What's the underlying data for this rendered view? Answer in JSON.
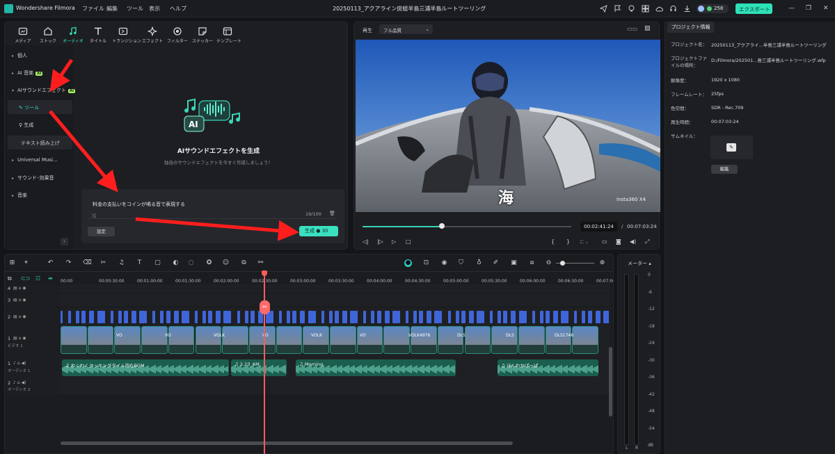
{
  "titlebar": {
    "app_name": "Wondershare Filmora",
    "menu": [
      "ファイル",
      "編集",
      "ツール",
      "表示",
      "ヘルプ"
    ],
    "project_title": "20250113_アクアライン房総半島三浦半島ルートツーリング",
    "credits": "258",
    "export_label": "エクスポート"
  },
  "media_tabs": [
    {
      "label": "メディア",
      "icon": "media-icon"
    },
    {
      "label": "ストック",
      "icon": "stock-icon"
    },
    {
      "label": "オーディオ",
      "icon": "music-note-icon"
    },
    {
      "label": "タイトル",
      "icon": "title-icon"
    },
    {
      "label": "トランジション",
      "icon": "transition-icon"
    },
    {
      "label": "エフェクト",
      "icon": "effect-icon"
    },
    {
      "label": "フィルター",
      "icon": "filter-icon"
    },
    {
      "label": "ステッカー",
      "icon": "sticker-icon"
    },
    {
      "label": "テンプレート",
      "icon": "template-icon"
    }
  ],
  "active_tab": "オーディオ",
  "sidebar": {
    "items": [
      {
        "label": "個人"
      },
      {
        "label": "AI 音楽",
        "badge": "AI"
      },
      {
        "label": "AIサウンドエフェクト",
        "badge": "AI"
      },
      {
        "label": "テキスト読み上げ"
      },
      {
        "label": "Universal Musi..."
      },
      {
        "label": "サウンド･効果音"
      },
      {
        "label": "音楽"
      }
    ],
    "subitems": [
      {
        "label": "ツール"
      },
      {
        "label": "生成"
      }
    ],
    "ai_badge": "AI"
  },
  "ai_panel": {
    "heading": "AIサウンドエフェクトを生成",
    "subtitle": "独自のサウンドエフェクトを今すぐ作成しましょう！",
    "prompt_text": "料金の支払いをコインが鳴る音で表現する",
    "char_count": "19/100",
    "settings_label": "設定",
    "generate_label": "生成",
    "generate_cost": "30"
  },
  "preview": {
    "label": "再生",
    "quality": "フル品質",
    "overlay_text": "海",
    "watermark": "Insta360 X4",
    "current_time": "00:02:41:24",
    "total_time": "00:07:03:24",
    "progress": 0.38
  },
  "project_info": {
    "tab": "プロジェクト情報",
    "rows": [
      {
        "key": "プロジェクト名：",
        "value": "20250113_アクアライ...半島三浦半島ルートツーリング"
      },
      {
        "key": "プロジェクトファイルの場所：",
        "value": "D:/Filmora/202501...島三浦半島ルートツーリング.wfp"
      },
      {
        "key": "解像度：",
        "value": "1920 x 1080"
      },
      {
        "key": "フレームレート：",
        "value": "25fps"
      },
      {
        "key": "色空間：",
        "value": "SDR - Rec.709"
      },
      {
        "key": "再生時間：",
        "value": "00:07:03:24"
      },
      {
        "key": "サムネイル：",
        "value": ""
      }
    ],
    "edit_label": "編集"
  },
  "timeline": {
    "ticks": [
      "00:00",
      "00:00:30:00",
      "00:01:00:00",
      "00:01:30:00",
      "00:02:00:00",
      "00:02:30:00",
      "00:03:00:00",
      "00:03:30:00",
      "00:04:00:00",
      "00:04:30:00",
      "00:05:00:00",
      "00:05:30:00",
      "00:06:00:00",
      "00:06:30:00",
      "00:07:00:00"
    ],
    "tracks": [
      {
        "num": "4"
      },
      {
        "num": "3"
      },
      {
        "num": "2"
      },
      {
        "num": "1",
        "label": "ビデオ 1"
      },
      {
        "num": "1",
        "label": "オーディオ 1"
      },
      {
        "num": "2",
        "label": "オーディオ 2"
      }
    ],
    "video_clips": [
      "VO",
      "VO",
      "VOLK",
      "VO",
      "VOLK",
      "VO",
      "VOLK4976",
      "DLS",
      "DLS",
      "DLS1746"
    ],
    "audio_clips": [
      "わくわくクッキングタイム的なBGM",
      "2.23_AM",
      "Morning",
      "ほんわかぱっぱ"
    ]
  },
  "meter": {
    "title": "メーター",
    "labels": [
      "0",
      "-6",
      "-12",
      "-18",
      "-24",
      "-30",
      "-36",
      "-42",
      "-48",
      "-54",
      "dB"
    ],
    "channels": [
      "L",
      "R"
    ]
  }
}
